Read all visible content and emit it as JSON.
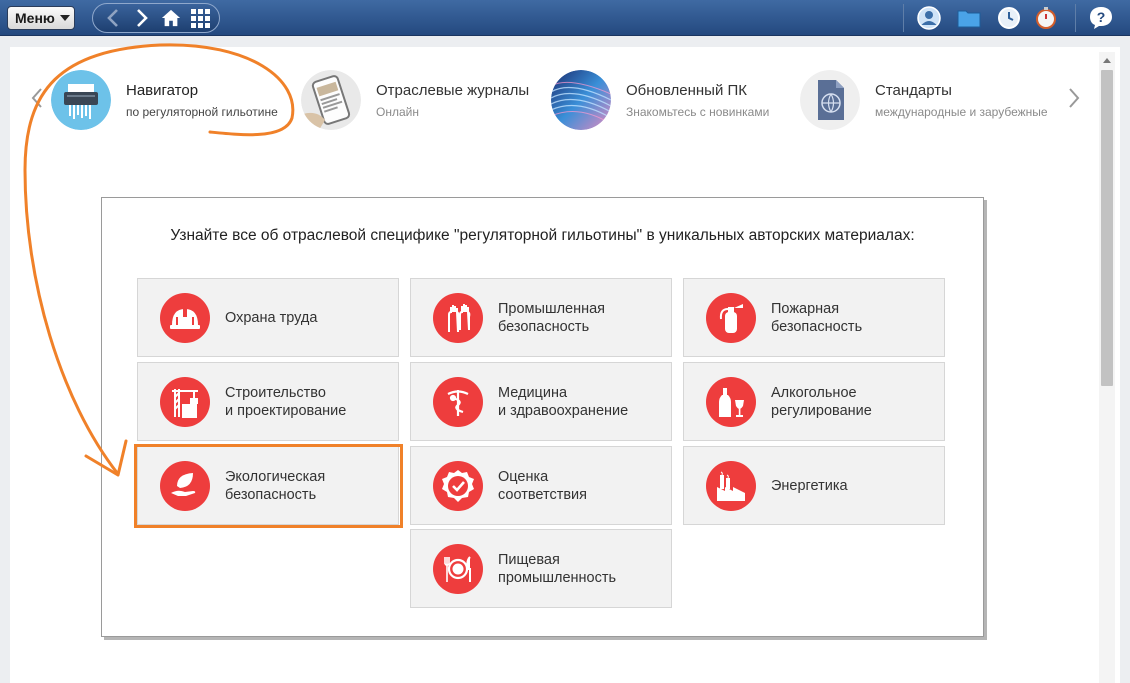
{
  "toolbar": {
    "menu_label": "Меню",
    "icons": [
      "back-icon",
      "forward-icon",
      "home-icon",
      "grid-icon",
      "user-icon",
      "folder-icon",
      "clock-icon",
      "stopwatch-icon",
      "help-icon"
    ]
  },
  "carousel": {
    "items": [
      {
        "title": "Навигатор",
        "subtitle": "по регуляторной гильотине"
      },
      {
        "title": "Отраслевые журналы",
        "subtitle": "Онлайн"
      },
      {
        "title": "Обновленный ПК",
        "subtitle": "Знакомьтесь с новинками"
      },
      {
        "title": "Стандарты",
        "subtitle": "международные и зарубежные"
      }
    ]
  },
  "content": {
    "headline": "Узнайте все об отраслевой специфике \"регуляторной гильотины\" в уникальных авторских материалах:",
    "tiles": [
      {
        "label": "Охрана труда",
        "icon": "hard-hat-icon"
      },
      {
        "label": "Промышленная\nбезопасность",
        "icon": "gloves-icon"
      },
      {
        "label": "Пожарная\nбезопасность",
        "icon": "fire-extinguisher-icon"
      },
      {
        "label": "Строительство\nи проектирование",
        "icon": "crane-icon"
      },
      {
        "label": "Медицина\nи здравоохранение",
        "icon": "caduceus-icon"
      },
      {
        "label": "Алкогольное\nрегулирование",
        "icon": "bottle-glass-icon"
      },
      {
        "label": "Экологическая\nбезопасность",
        "icon": "leaf-hand-icon"
      },
      {
        "label": "Оценка\nсоответствия",
        "icon": "check-badge-icon"
      },
      {
        "label": "Энергетика",
        "icon": "factory-icon"
      },
      {
        "label": "Пищевая\nпромышленность",
        "icon": "plate-cutlery-icon"
      }
    ]
  },
  "colors": {
    "topbar": "#2f5a92",
    "accent_red": "#ee3d3d",
    "annotation_orange": "#f08129"
  }
}
